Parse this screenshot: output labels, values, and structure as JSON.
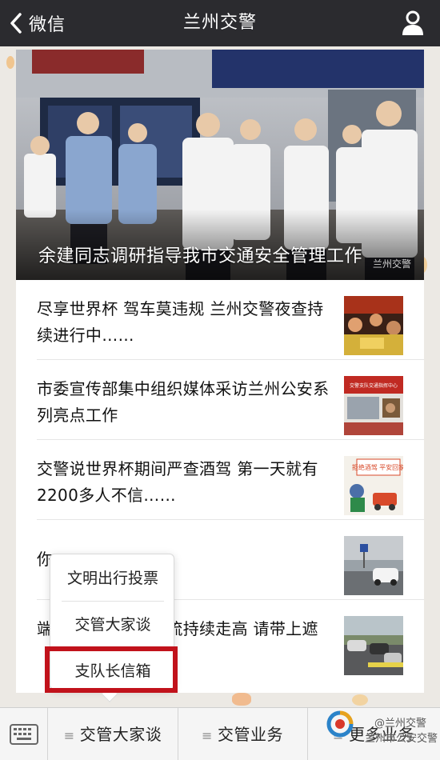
{
  "header": {
    "back_label": "微信",
    "title": "兰州交警"
  },
  "hero": {
    "caption": "余建同志调研指导我市交通安全管理工作",
    "watermark": "兰州交警"
  },
  "news": [
    {
      "title": "尽享世界杯 驾车莫违规 兰州交警夜查持续进行中……"
    },
    {
      "title": "市委宣传部集中组织媒体采访兰州公安系列亮点工作",
      "thumb_text": "交警支队交通指挥中心"
    },
    {
      "title": "交警说世界杯期间严查酒驾 第一天就有2200多人不信……",
      "thumb_text": "拒绝酒驾 平安回家"
    },
    {
      "title": "你"
    },
    {
      "title": "端　　　　　　　流持续走高 请带上遮"
    }
  ],
  "popup_menu": {
    "items": [
      "文明出行投票",
      "交管大家谈",
      "支队长信箱"
    ],
    "highlighted": "支队长信箱"
  },
  "bottom_menu": {
    "tabs": [
      {
        "label": "交管大家谈",
        "icon": "menu-lines-icon"
      },
      {
        "label": "交管业务",
        "icon": "menu-lines-icon"
      },
      {
        "label": "更多业务",
        "icon": "menu-lines-icon"
      }
    ]
  },
  "watermark": {
    "line1": "@兰州交警",
    "line2": "兰州市公安交警"
  },
  "colors": {
    "header_bg": "#2b2b2f",
    "highlight_red": "#c1121b",
    "page_bg": "#ece9e4"
  }
}
